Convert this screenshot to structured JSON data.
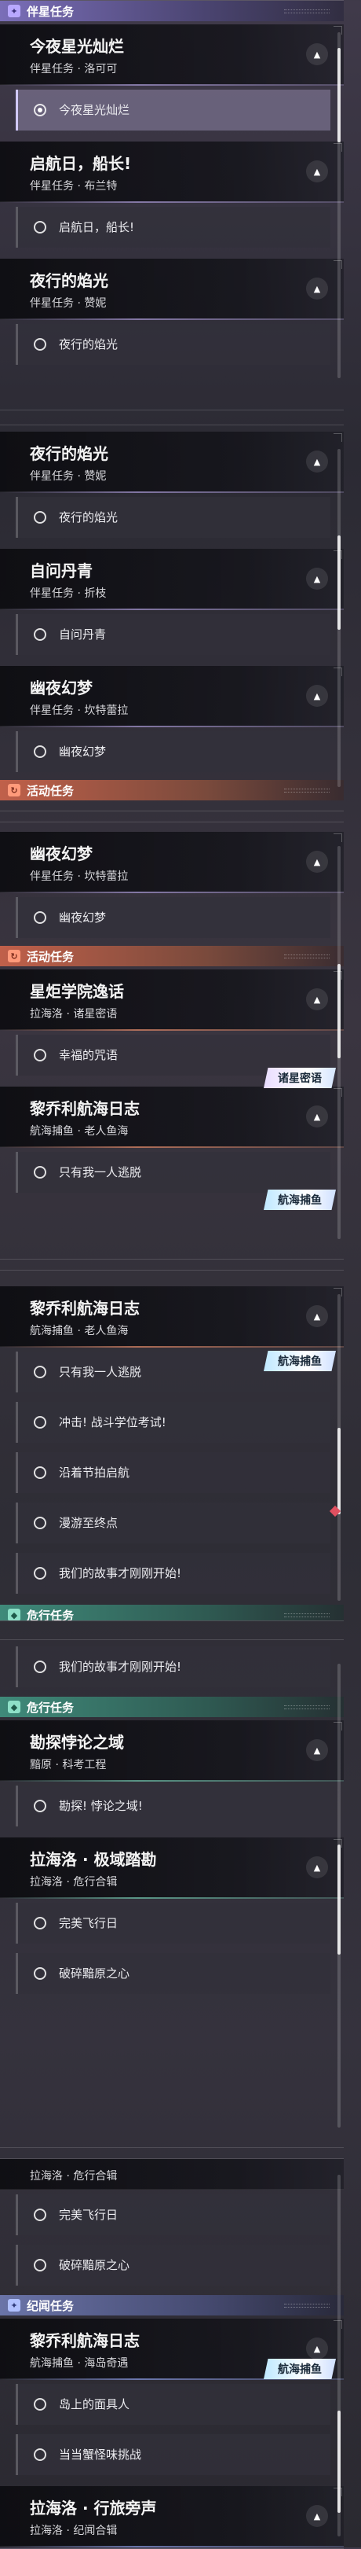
{
  "categories": {
    "companion": "伴星任务",
    "activity": "活动任务",
    "danger": "危行任务",
    "chronicle": "纪闻任务"
  },
  "missions": {
    "tonight_stars": {
      "title": "今夜星光灿烂",
      "subtitle": "伴星任务 · 洛可可"
    },
    "set_sail": {
      "title": "启航日，船长!",
      "subtitle": "伴星任务 · 布兰特"
    },
    "night_flame": {
      "title": "夜行的焰光",
      "subtitle": "伴星任务 · 赞妮"
    },
    "ask_danqing": {
      "title": "自问丹青",
      "subtitle": "伴星任务 · 折枝"
    },
    "dark_dream": {
      "title": "幽夜幻梦",
      "subtitle": "伴星任务 · 坎特蕾拉"
    },
    "academy": {
      "title": "星炬学院逸话",
      "subtitle": "拉海洛 · 诸星密语"
    },
    "voyage_log": {
      "title": "黎乔利航海日志",
      "subtitle": "航海捕鱼 · 老人鱼海"
    },
    "paradox": {
      "title": "勘探悖论之域",
      "subtitle": "黯原 · 科考工程"
    },
    "polar_roam": {
      "title": "拉海洛 · 极域踏勘",
      "subtitle": "拉海洛 · 危行合辑"
    },
    "voyage_log2": {
      "title": "黎乔利航海日志",
      "subtitle": "航海捕鱼 · 海岛奇遇"
    },
    "journey": {
      "title": "拉海洛 · 行旅旁声",
      "subtitle": "拉海洛 · 纪闻合辑"
    }
  },
  "subtasks": {
    "tonight_stars": "今夜星光灿烂",
    "set_sail": "启航日，船长!",
    "night_flame": "夜行的焰光",
    "ask_danqing": "自问丹青",
    "dark_dream": "幽夜幻梦",
    "lucky_spell": "幸福的咒语",
    "only_me": "只有我一人逃脱",
    "charge": "冲击! 战斗学位考试!",
    "follow_beat": "沿着节拍启航",
    "drift_end": "漫游至终点",
    "story_begin": "我们的故事才刚刚开始!",
    "paradox_run": "勘探! 悖论之域!",
    "perfect_flight": "完美飞行日",
    "broken_heart": "破碎黯原之心",
    "island_man": "岛上的面具人",
    "crab_challenge": "当当蟹怪味挑战"
  },
  "badges": {
    "star_whisper": "诸星密语",
    "fishing": "航海捕鱼"
  },
  "icons": {
    "companion": "sparkle-icon",
    "activity": "swirl-icon",
    "danger": "shield-icon",
    "chronicle": "star-icon",
    "expand": "chevron-up-icon"
  },
  "colors": {
    "companion": "#7a6eb8",
    "activity": "#c0604a",
    "danger": "#3f8a7a",
    "chronicle": "#6a74a8",
    "alert": "#e05060"
  }
}
